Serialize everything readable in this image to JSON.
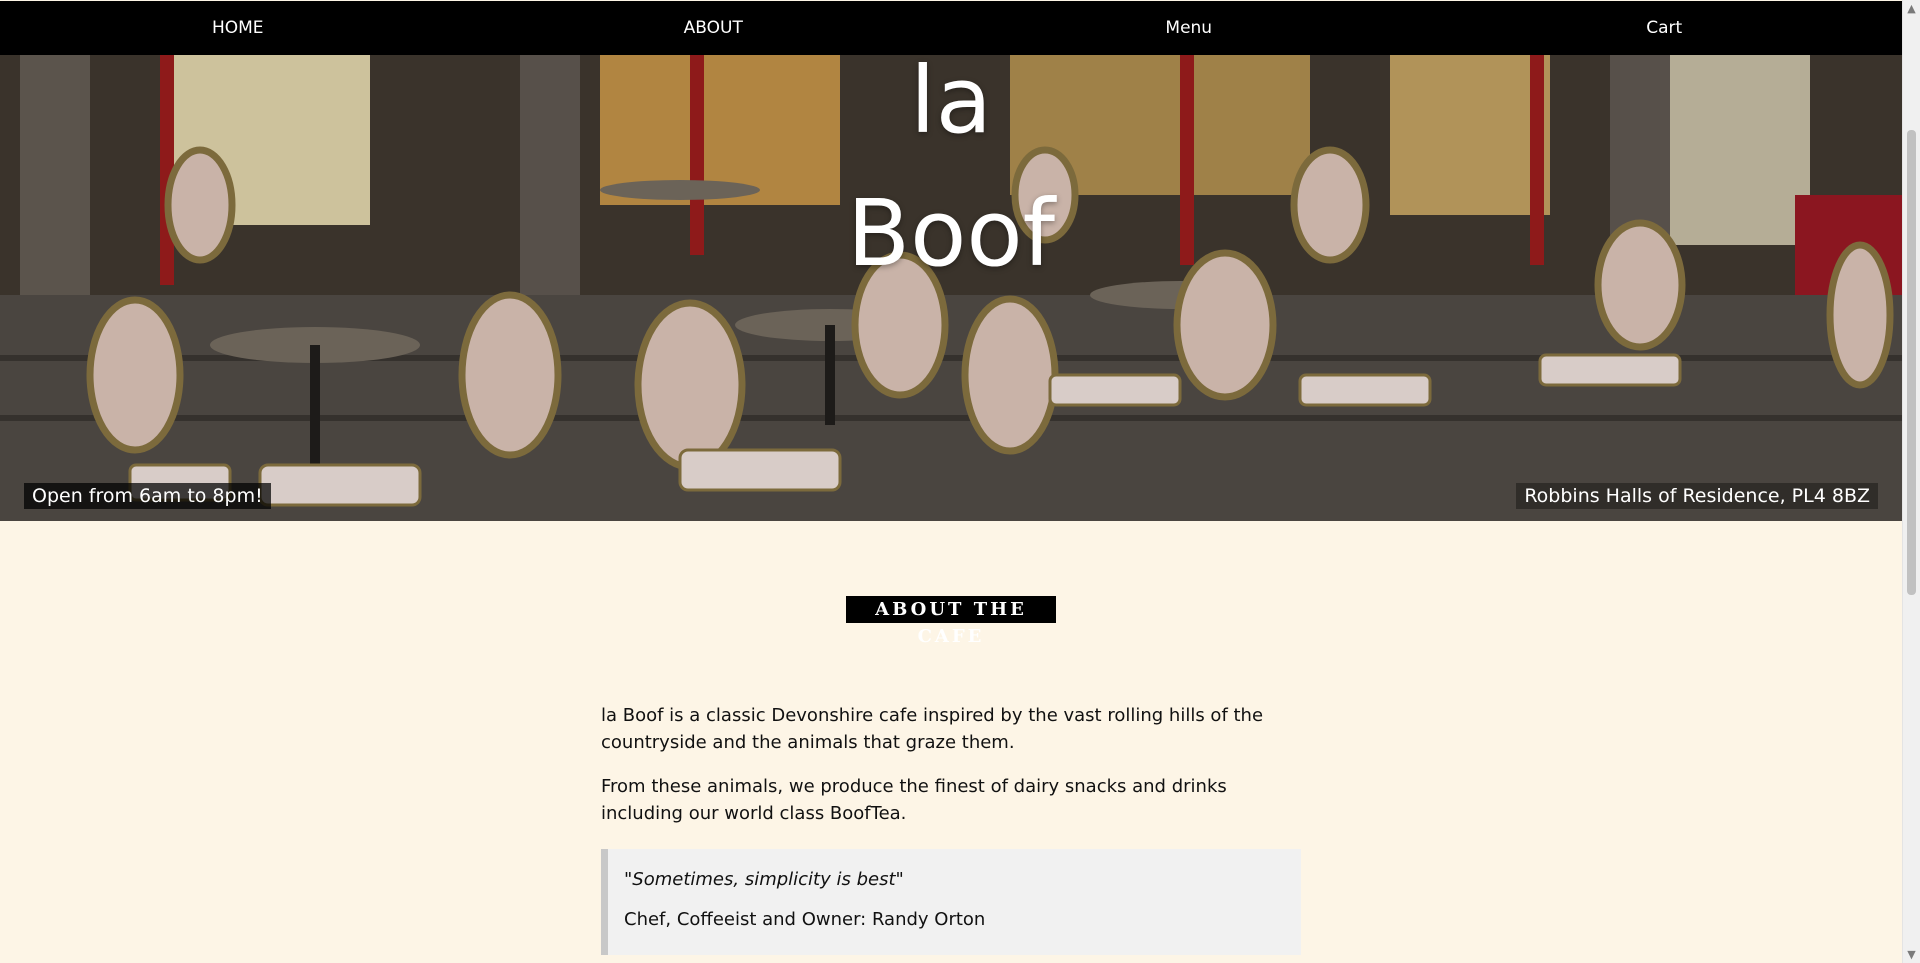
{
  "nav": {
    "home": "HOME",
    "about": "ABOUT",
    "menu": "Menu",
    "cart": "Cart"
  },
  "hero": {
    "title_line1": "la",
    "title_line2": "Boof",
    "hours": "Open from 6am to 8pm!",
    "address": "Robbins Halls of Residence, PL4 8BZ"
  },
  "about": {
    "heading": "ABOUT THE CAFE",
    "paragraph1": "la Boof is a classic Devonshire cafe inspired by the vast rolling hills of the countryside and the animals that graze them.",
    "paragraph2": "From these animals, we produce the finest of dairy snacks and drinks including our world class BoofTea.",
    "quote": "\"Sometimes, simplicity is best\"",
    "quote_author": "Chef, Coffeeist and Owner: Randy Orton"
  },
  "colors": {
    "nav_bg": "#000000",
    "page_bg": "#fdf5e6",
    "quote_bg": "#f1f1f1"
  }
}
